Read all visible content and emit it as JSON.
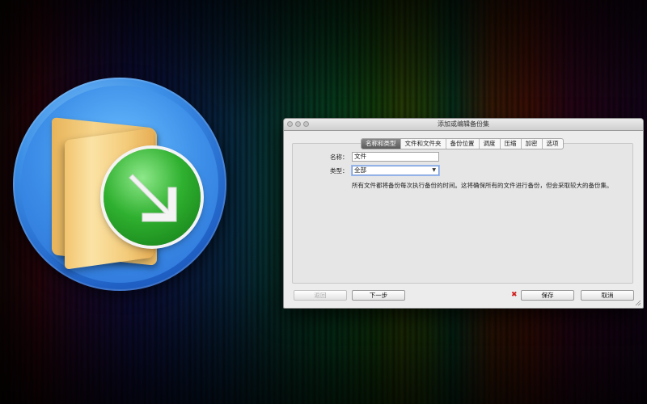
{
  "dialog": {
    "title": "添加或编辑备份集",
    "tabs": [
      {
        "label": "名称和类型",
        "active": true
      },
      {
        "label": "文件和文件夹",
        "active": false
      },
      {
        "label": "备份位置",
        "active": false
      },
      {
        "label": "调度",
        "active": false
      },
      {
        "label": "压缩",
        "active": false
      },
      {
        "label": "加密",
        "active": false
      },
      {
        "label": "选项",
        "active": false
      }
    ],
    "name_label": "名称：",
    "name_value": "文件",
    "type_label": "类型：",
    "type_value": "全部",
    "description": "所有文件都将备份每次执行备份的时间。这将确保所有的文件进行备份，但会采取较大的备份集。",
    "buttons": {
      "back": "返回",
      "next": "下一步",
      "save": "保存",
      "cancel": "取消"
    }
  },
  "icons": {
    "app": "folder-with-green-arrow-icon",
    "error": "red-x-icon"
  },
  "colors": {
    "accent_green": "#2fb02f",
    "icon_blue": "#3c8fe6",
    "folder_yellow": "#f2c46e",
    "error_red": "#d02020"
  }
}
